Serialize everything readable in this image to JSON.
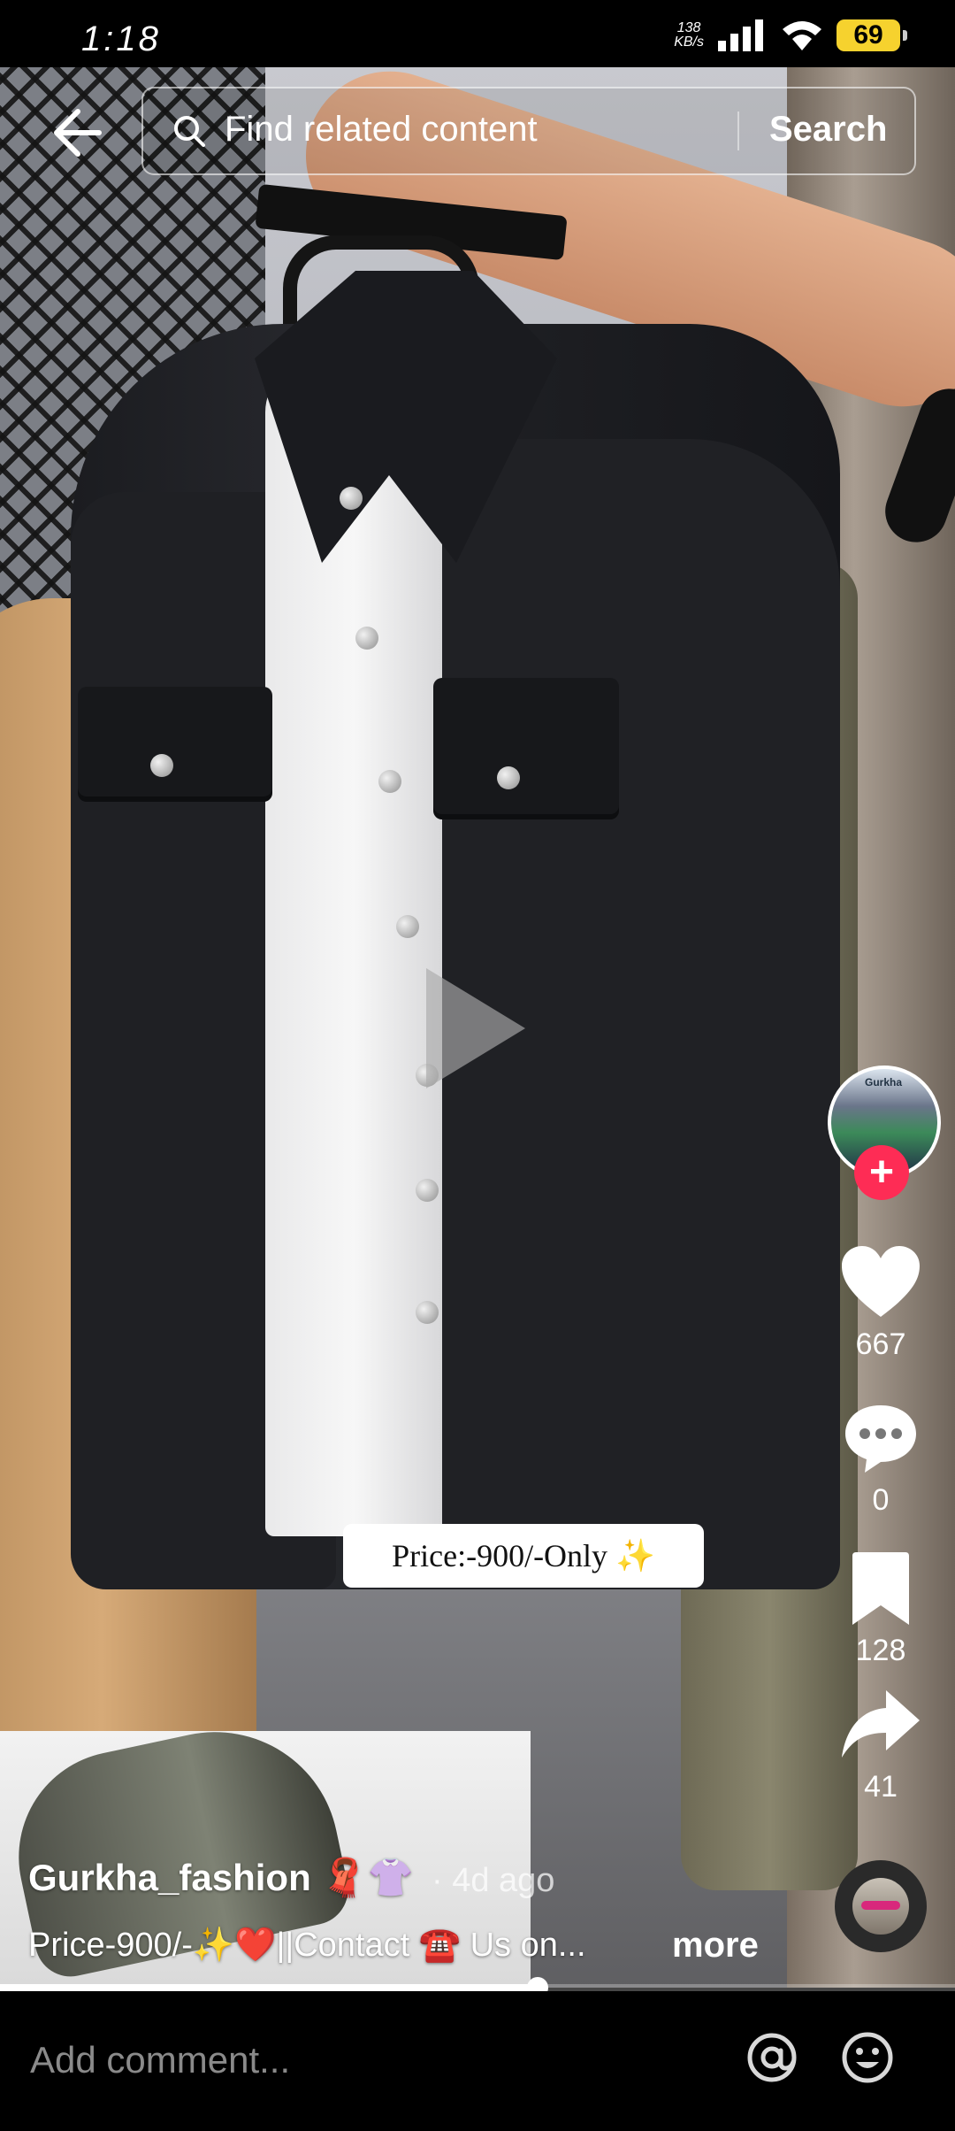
{
  "status_bar": {
    "time": "1:18",
    "speed_value": "138",
    "speed_unit": "KB/s",
    "battery": "69"
  },
  "search": {
    "placeholder": "Find related content",
    "button": "Search"
  },
  "video": {
    "price_text": "Price:-900/-Only ✨"
  },
  "sidebar": {
    "likes": "667",
    "comments": "0",
    "saves": "128",
    "shares": "41",
    "avatar_text": "Gurkha"
  },
  "caption": {
    "username": "Gurkha_fashion",
    "username_emoji": "🧣👚",
    "time": "· 4d ago",
    "text": "Price-900/-✨❤️||Contact ☎️ Us on...",
    "more": "more"
  },
  "playback": {
    "progress_fraction": 0.563
  },
  "bottom": {
    "comment_placeholder": "Add comment..."
  },
  "icons": [
    "back-arrow-icon",
    "search-icon",
    "play-icon",
    "heart-icon",
    "comment-icon",
    "bookmark-icon",
    "share-icon",
    "at-icon",
    "emoji-icon"
  ],
  "colors": {
    "follow": "#fe2c55",
    "battery": "#f6d22e"
  }
}
